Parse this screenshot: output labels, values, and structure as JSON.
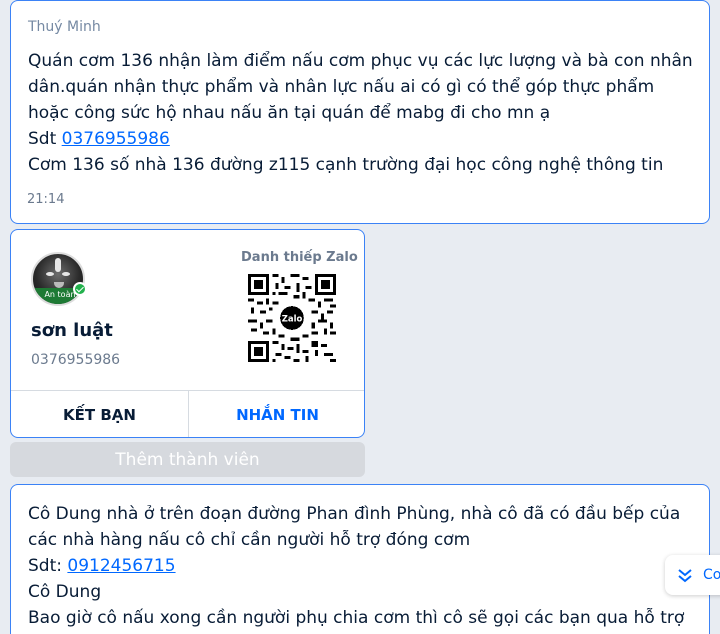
{
  "message1": {
    "sender": "Thuý Minh",
    "line1": "Quán cơm 136 nhận làm điểm nấu cơm phục vụ các lực lượng và bà con nhân dân.quán nhận thực phẩm và nhân lực nấu ai có gì có thể góp thực phẩm hoặc công sức hộ nhau nấu ăn tại quán để mabg đi cho mn ạ",
    "phone_prefix": "Sdt ",
    "phone": "0376955986",
    "line3": "Cơm 136 số nhà 136 đường z115 cạnh trường đại học công nghệ thông tin",
    "time": "21:14"
  },
  "contact_card": {
    "avatar_badge": "An toàn",
    "card_title": "Danh thiếp Zalo",
    "qr_logo": "Zalo",
    "name": "sơn luật",
    "phone": "0376955986",
    "add_friend_label": "KẾT BẠN",
    "message_label": "NHẮN TIN"
  },
  "add_member_label": "Thêm thành viên",
  "message2": {
    "line1": "Cô Dung nhà ở trên đoạn đường Phan đình Phùng, nhà cô đã có đầu bếp của các nhà hàng nấu cô chỉ cần người hỗ trợ đóng cơm",
    "phone_prefix": "Sdt: ",
    "phone": "0912456715",
    "line3": "Cô Dung",
    "line4": "Bao giờ cô nấu xong cần người phụ chia cơm thì cô sẽ gọi các bạn qua hỗ trợ"
  },
  "scroll_button": {
    "label": "Co",
    "icon": "chevrons-down-icon"
  },
  "colors": {
    "accent": "#0068ff",
    "border": "#3b82f6",
    "background": "#e8ecf2",
    "verified": "#22b14c"
  }
}
